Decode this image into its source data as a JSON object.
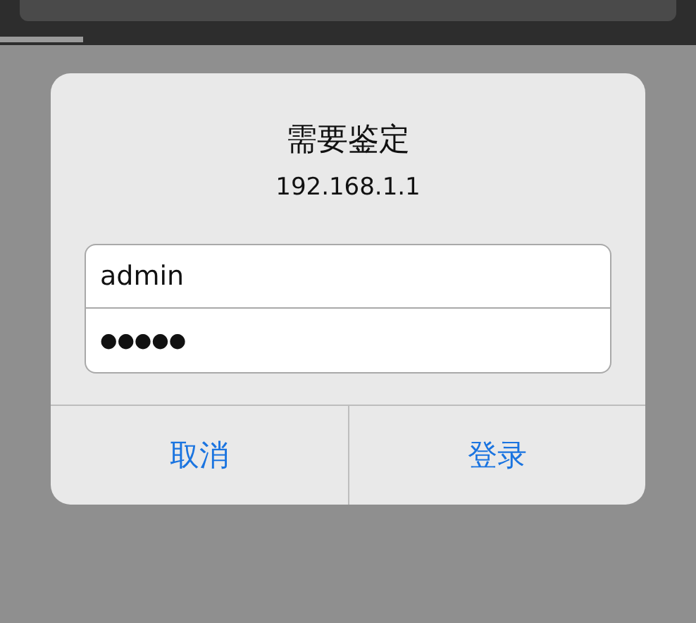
{
  "browser": {
    "progress": {
      "level": 0.12
    }
  },
  "dialog": {
    "title": "需要鉴定",
    "message": "192.168.1.1",
    "fields": [
      {
        "kind": "text",
        "value": "admin"
      },
      {
        "kind": "password",
        "value": "●●●●●"
      }
    ],
    "buttons": [
      {
        "label": "取消"
      },
      {
        "label": "登录"
      }
    ]
  }
}
